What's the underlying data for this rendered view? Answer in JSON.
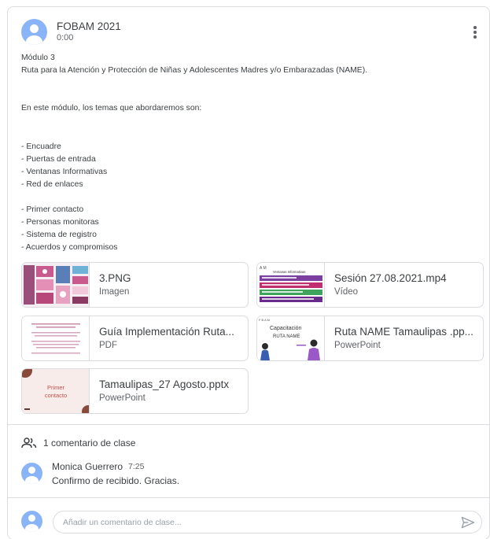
{
  "post": {
    "author": "FOBAM 2021",
    "time": "0:00",
    "body": "Módulo 3\nRuta para la Atención y Protección de Niñas y Adolescentes Madres y/o Embarazadas (NAME).\n\n\nEn este módulo, los temas que abordaremos son:\n\n\n- Encuadre\n- Puertas de entrada\n- Ventanas Informativas\n- Red de enlaces\n\n- Primer contacto\n- Personas monitoras\n- Sistema de registro\n- Acuerdos y compromisos"
  },
  "attachments": [
    {
      "title": "3.PNG",
      "type": "Imagen"
    },
    {
      "title": "Sesión 27.08.2021.mp4",
      "type": "Vídeo"
    },
    {
      "title": "Guía Implementación Ruta...",
      "type": "PDF"
    },
    {
      "title": "Ruta NAME Tamaulipas .pp...",
      "type": "PowerPoint"
    },
    {
      "title": "Tamaulipas_27 Agosto.pptx",
      "type": "PowerPoint"
    }
  ],
  "thumbs": {
    "name_slide_title": "Capacitación",
    "name_slide_sub": "RUTA NAME",
    "name_slide_corner": "F B A M",
    "tamaulipas_line1": "Primer",
    "tamaulipas_line2": "contacto",
    "video_header": "Ventanas Informativas",
    "video_corner": "A M"
  },
  "comments": {
    "count_label": "1 comentario de clase",
    "items": [
      {
        "author": "Monica Guerrero",
        "time": "7:25",
        "text": "Confirmo de recibido. Gracias."
      }
    ],
    "input_placeholder": "Añadir un comentario de clase..."
  },
  "icons": {
    "more": "more-vert-icon",
    "people": "people-icon",
    "send": "send-icon"
  },
  "colors": {
    "avatar": "#8ab4f8",
    "border": "#dadce0",
    "text": "#3c4043",
    "secondary": "#5f6368"
  }
}
